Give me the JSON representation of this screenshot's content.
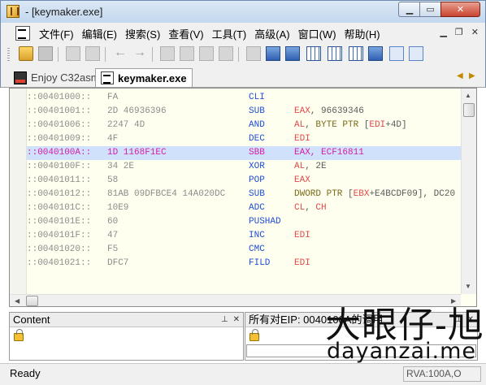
{
  "window": {
    "title": "- [keymaker.exe]"
  },
  "menu": {
    "items": [
      "文件(F)",
      "编辑(E)",
      "搜索(S)",
      "查看(V)",
      "工具(T)",
      "高级(A)",
      "窗口(W)",
      "帮助(H)"
    ]
  },
  "tabs": [
    {
      "label": "Enjoy C32asm",
      "active": false
    },
    {
      "label": "keymaker.exe",
      "active": true
    }
  ],
  "disasm": {
    "lines": [
      {
        "addr": "::00401000::",
        "hex": "FA",
        "mn": "CLI",
        "ops": []
      },
      {
        "addr": "::00401001::",
        "hex": "2D 46936396",
        "mn": "SUB",
        "ops": [
          {
            "t": "EAX",
            "k": "reg"
          },
          {
            "t": ", 96639346",
            "k": "plain"
          }
        ]
      },
      {
        "addr": "::00401006::",
        "hex": "2247 4D",
        "mn": "AND",
        "ops": [
          {
            "t": "AL",
            "k": "reg"
          },
          {
            "t": ", ",
            "k": "plain"
          },
          {
            "t": "BYTE PTR",
            "k": "kw"
          },
          {
            "t": " [",
            "k": "plain"
          },
          {
            "t": "EDI",
            "k": "reg"
          },
          {
            "t": "+4D]",
            "k": "plain"
          }
        ]
      },
      {
        "addr": "::00401009::",
        "hex": "4F",
        "mn": "DEC",
        "ops": [
          {
            "t": "EDI",
            "k": "reg"
          }
        ]
      },
      {
        "addr": "::0040100A::",
        "hex": "1D 1168F1EC",
        "mn": "SBB",
        "ops": [
          {
            "t": "EAX, ECF16811",
            "k": "plain"
          }
        ],
        "selected": true
      },
      {
        "addr": "::0040100F::",
        "hex": "34 2E",
        "mn": "XOR",
        "ops": [
          {
            "t": "AL",
            "k": "reg"
          },
          {
            "t": ", 2E",
            "k": "plain"
          }
        ]
      },
      {
        "addr": "::00401011::",
        "hex": "58",
        "mn": "POP",
        "ops": [
          {
            "t": "EAX",
            "k": "reg"
          }
        ]
      },
      {
        "addr": "::00401012::",
        "hex": "81AB 09DFBCE4 14A020DC",
        "mn": "SUB",
        "ops": [
          {
            "t": "DWORD PTR",
            "k": "kw"
          },
          {
            "t": " [",
            "k": "plain"
          },
          {
            "t": "EBX",
            "k": "reg"
          },
          {
            "t": "+E4BCDF09], DC20",
            "k": "plain"
          }
        ]
      },
      {
        "addr": "::0040101C::",
        "hex": "10E9",
        "mn": "ADC",
        "ops": [
          {
            "t": "CL",
            "k": "reg"
          },
          {
            "t": ", ",
            "k": "plain"
          },
          {
            "t": "CH",
            "k": "reg"
          }
        ]
      },
      {
        "addr": "::0040101E::",
        "hex": "60",
        "mn": "PUSHAD",
        "ops": []
      },
      {
        "addr": "::0040101F::",
        "hex": "47",
        "mn": "INC",
        "ops": [
          {
            "t": "EDI",
            "k": "reg"
          }
        ]
      },
      {
        "addr": "::00401020::",
        "hex": "F5",
        "mn": "CMC",
        "ops": []
      },
      {
        "addr": "::00401021::",
        "hex": "DFC7",
        "mn": "FILD",
        "ops": [
          {
            "t": "EDI",
            "k": "reg"
          }
        ]
      }
    ]
  },
  "panels": {
    "left_title": "Content",
    "right_title": "所有对EIP: 0040100A的调用"
  },
  "watermark": {
    "cn": "大眼仔-旭",
    "en": "dayanzai.me"
  },
  "status": {
    "text": "Ready",
    "rva": "RVA:100A,O"
  }
}
